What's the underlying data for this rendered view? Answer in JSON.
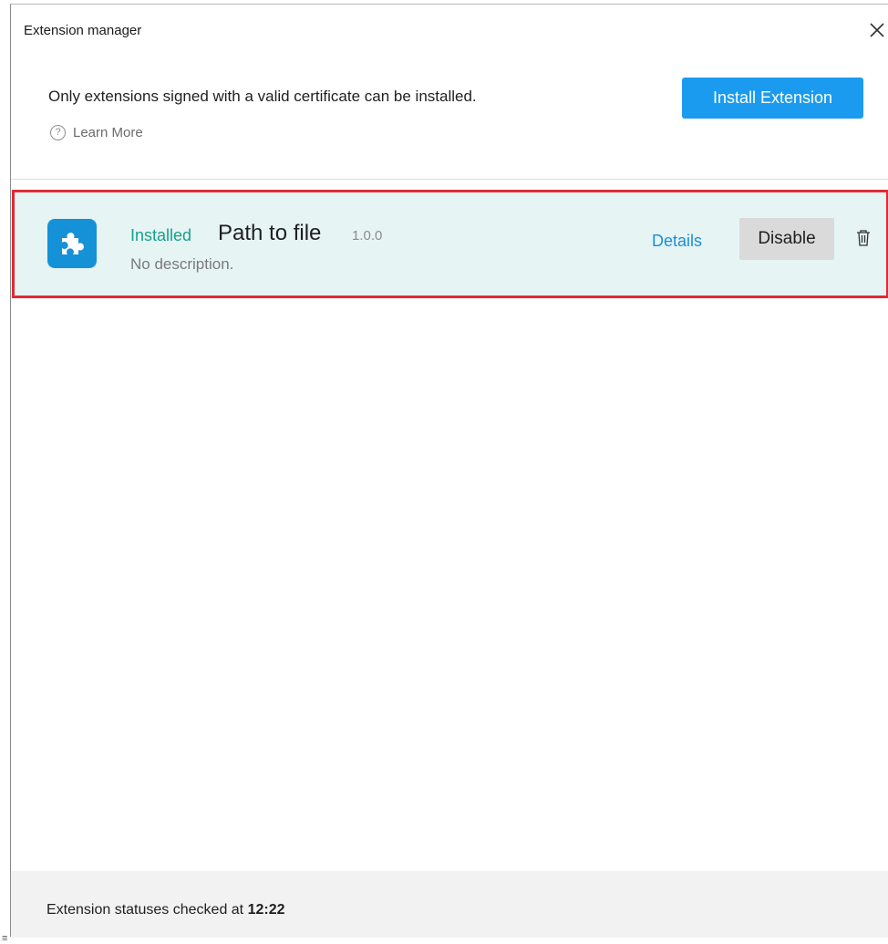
{
  "window": {
    "title": "Extension manager",
    "close_icon": "close-icon"
  },
  "header": {
    "notice": "Only extensions signed with a valid certificate can be installed.",
    "learn_more_label": "Learn More",
    "learn_more_icon": "help-circle-icon",
    "help_glyph": "?",
    "install_button_label": "Install Extension"
  },
  "extensions": [
    {
      "status": "Installed",
      "name": "Path to file",
      "version": "1.0.0",
      "description": "No description.",
      "icon": "puzzle-icon",
      "details_label": "Details",
      "disable_label": "Disable",
      "delete_icon": "trash-icon"
    }
  ],
  "footer": {
    "status_prefix": "Extension statuses checked at",
    "status_time": "12:22"
  },
  "colors": {
    "accent": "#1b9bef",
    "installed_status": "#18a08a",
    "selected_row_bg": "#e6f4f4",
    "selected_row_border": "#e02b35",
    "link": "#1b8fd8"
  }
}
